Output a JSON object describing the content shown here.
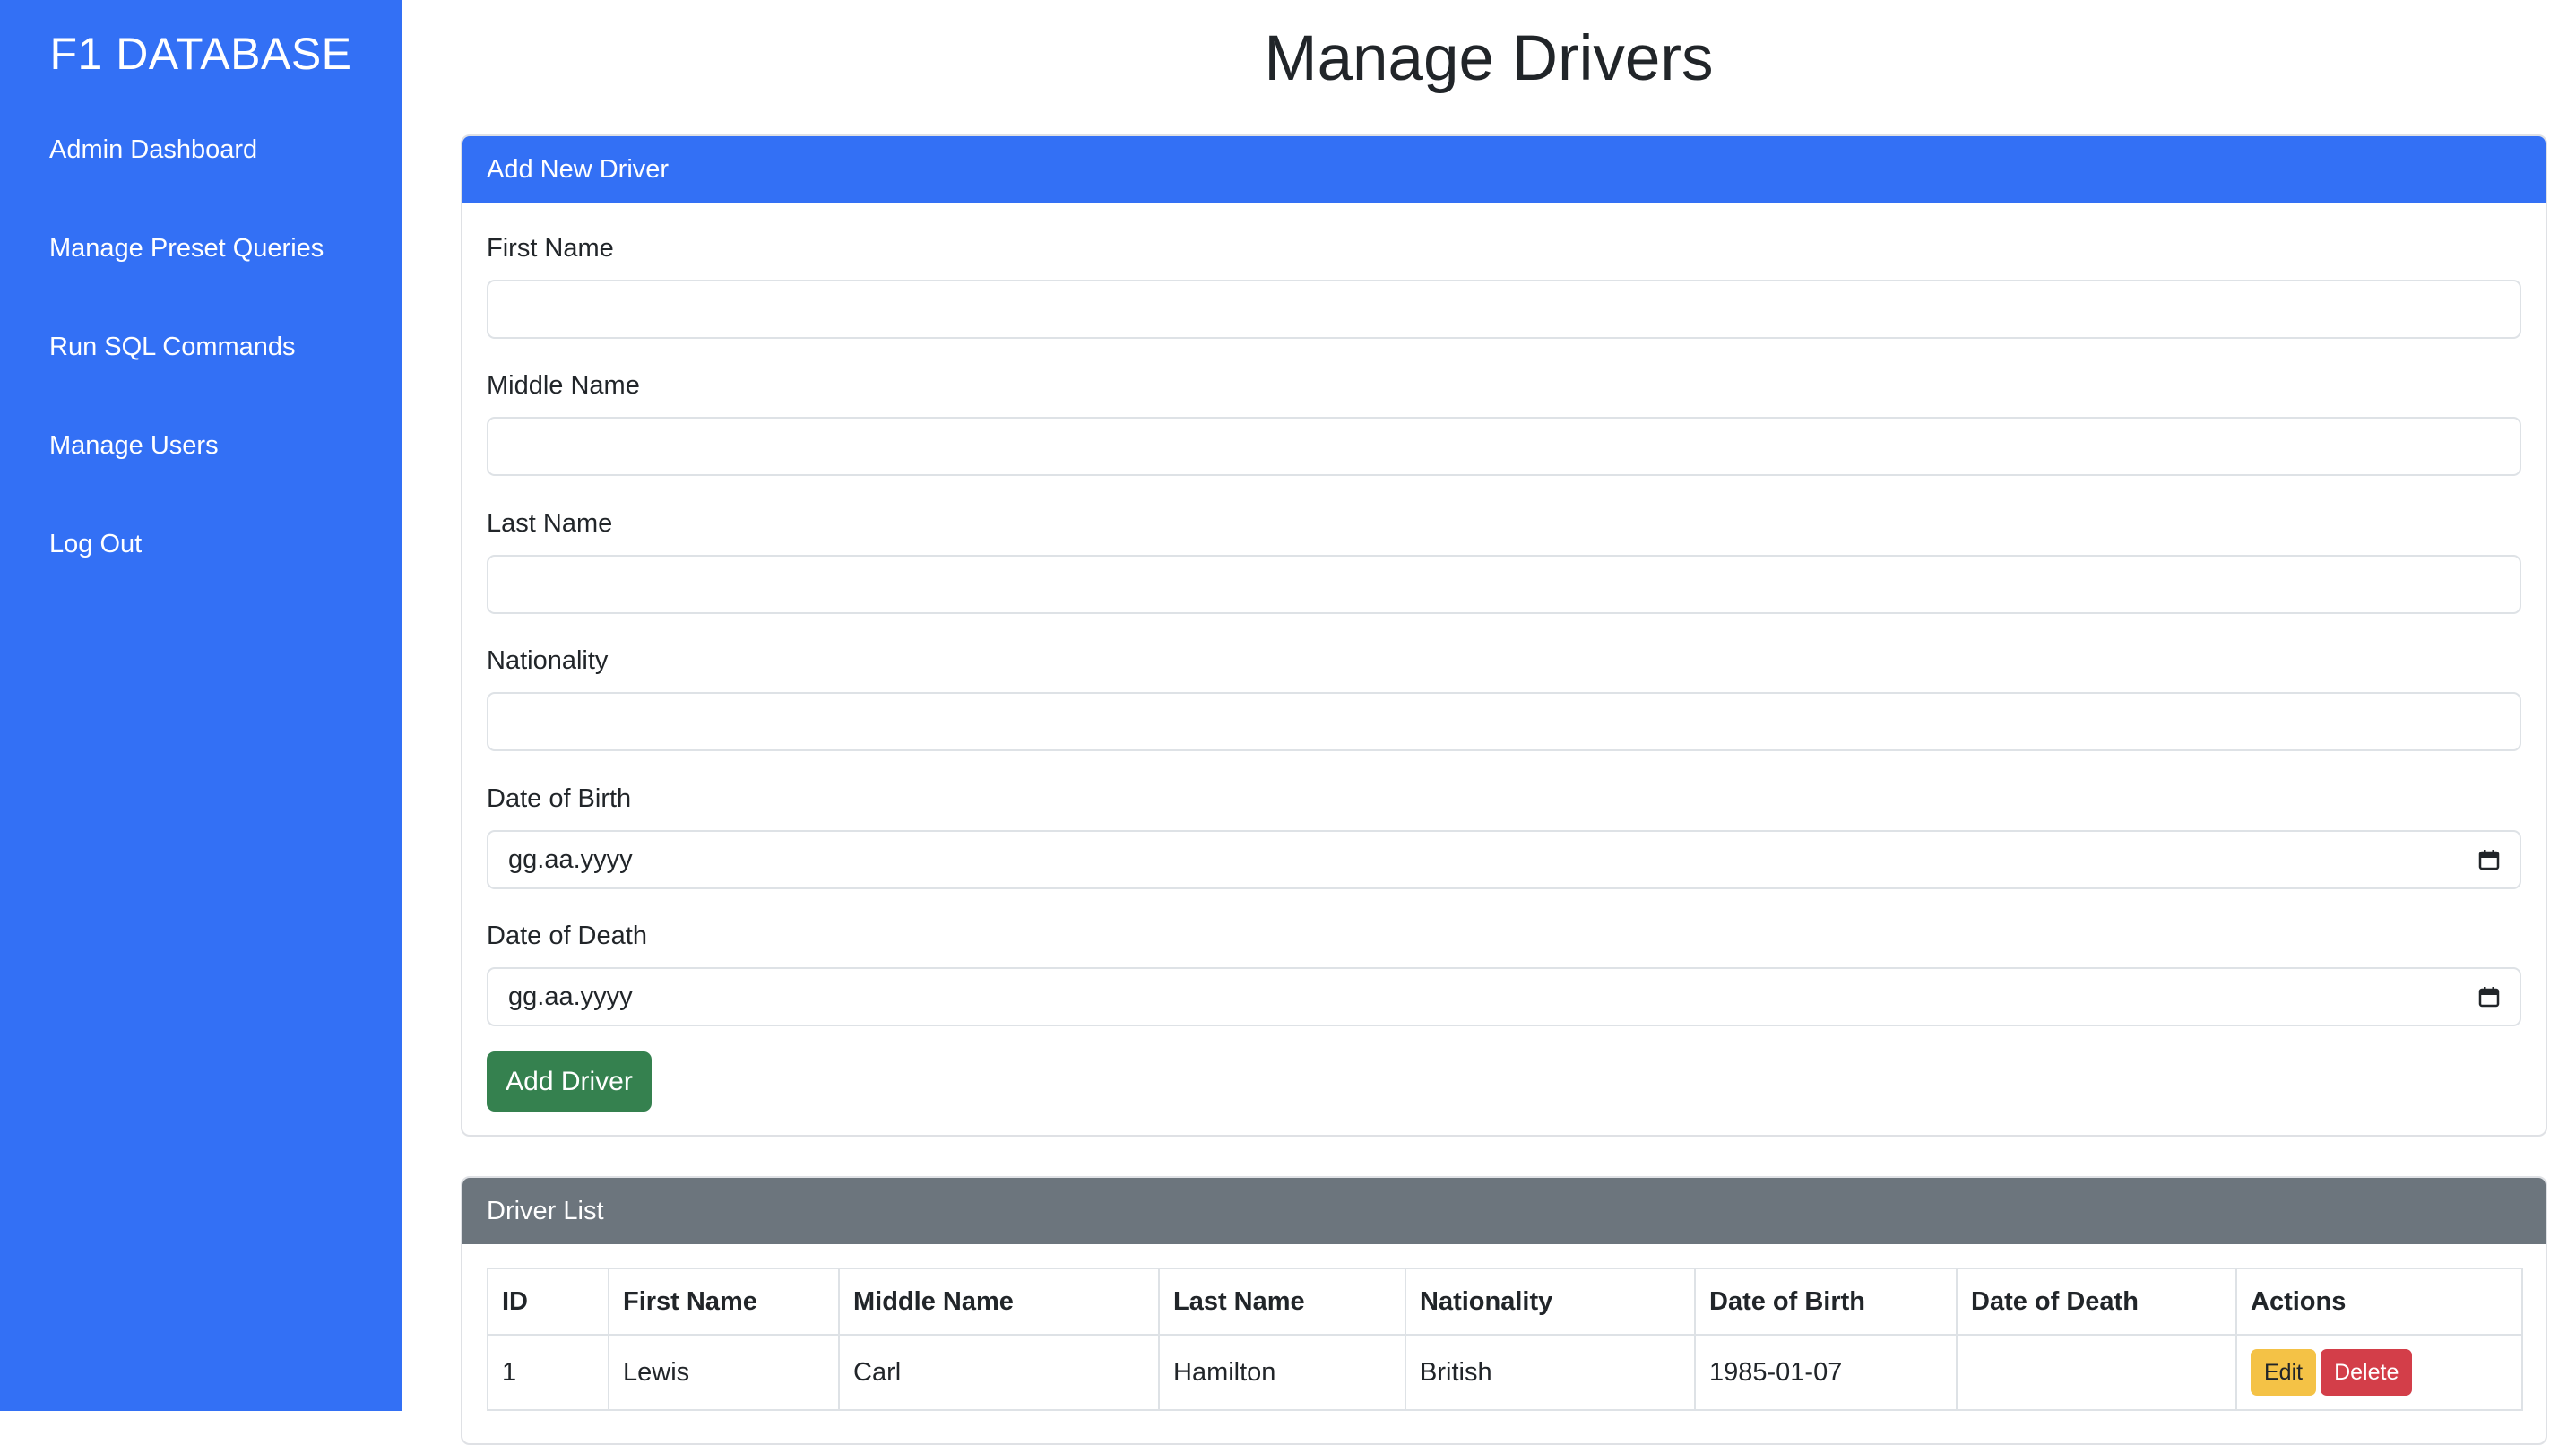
{
  "sidebar": {
    "brand": "F1 DATABASE",
    "items": [
      {
        "label": "Admin Dashboard"
      },
      {
        "label": "Manage Preset Queries"
      },
      {
        "label": "Run SQL Commands"
      },
      {
        "label": "Manage Users"
      },
      {
        "label": "Log Out"
      }
    ],
    "bg_color": "#3370f5"
  },
  "page": {
    "title": "Manage Drivers"
  },
  "add_form": {
    "header": "Add New Driver",
    "fields": [
      {
        "label": "First Name",
        "value": ""
      },
      {
        "label": "Middle Name",
        "value": ""
      },
      {
        "label": "Last Name",
        "value": ""
      },
      {
        "label": "Nationality",
        "value": ""
      },
      {
        "label": "Date of Birth",
        "value": "gg.aa.yyyy",
        "icon": "calendar-icon"
      },
      {
        "label": "Date of Death",
        "value": "gg.aa.yyyy",
        "icon": "calendar-icon"
      }
    ],
    "submit_label": "Add Driver",
    "submit_color": "#35814f"
  },
  "driver_list": {
    "header": "Driver List",
    "columns": [
      "ID",
      "First Name",
      "Middle Name",
      "Last Name",
      "Nationality",
      "Date of Birth",
      "Date of Death",
      "Actions"
    ],
    "rows": [
      {
        "id": "1",
        "first_name": "Lewis",
        "middle_name": "Carl",
        "last_name": "Hamilton",
        "nationality": "British",
        "dob": "1985-01-07",
        "dod": "",
        "edit_label": "Edit",
        "delete_label": "Delete"
      }
    ],
    "edit_color": "#f4c246",
    "delete_color": "#d33e49"
  }
}
